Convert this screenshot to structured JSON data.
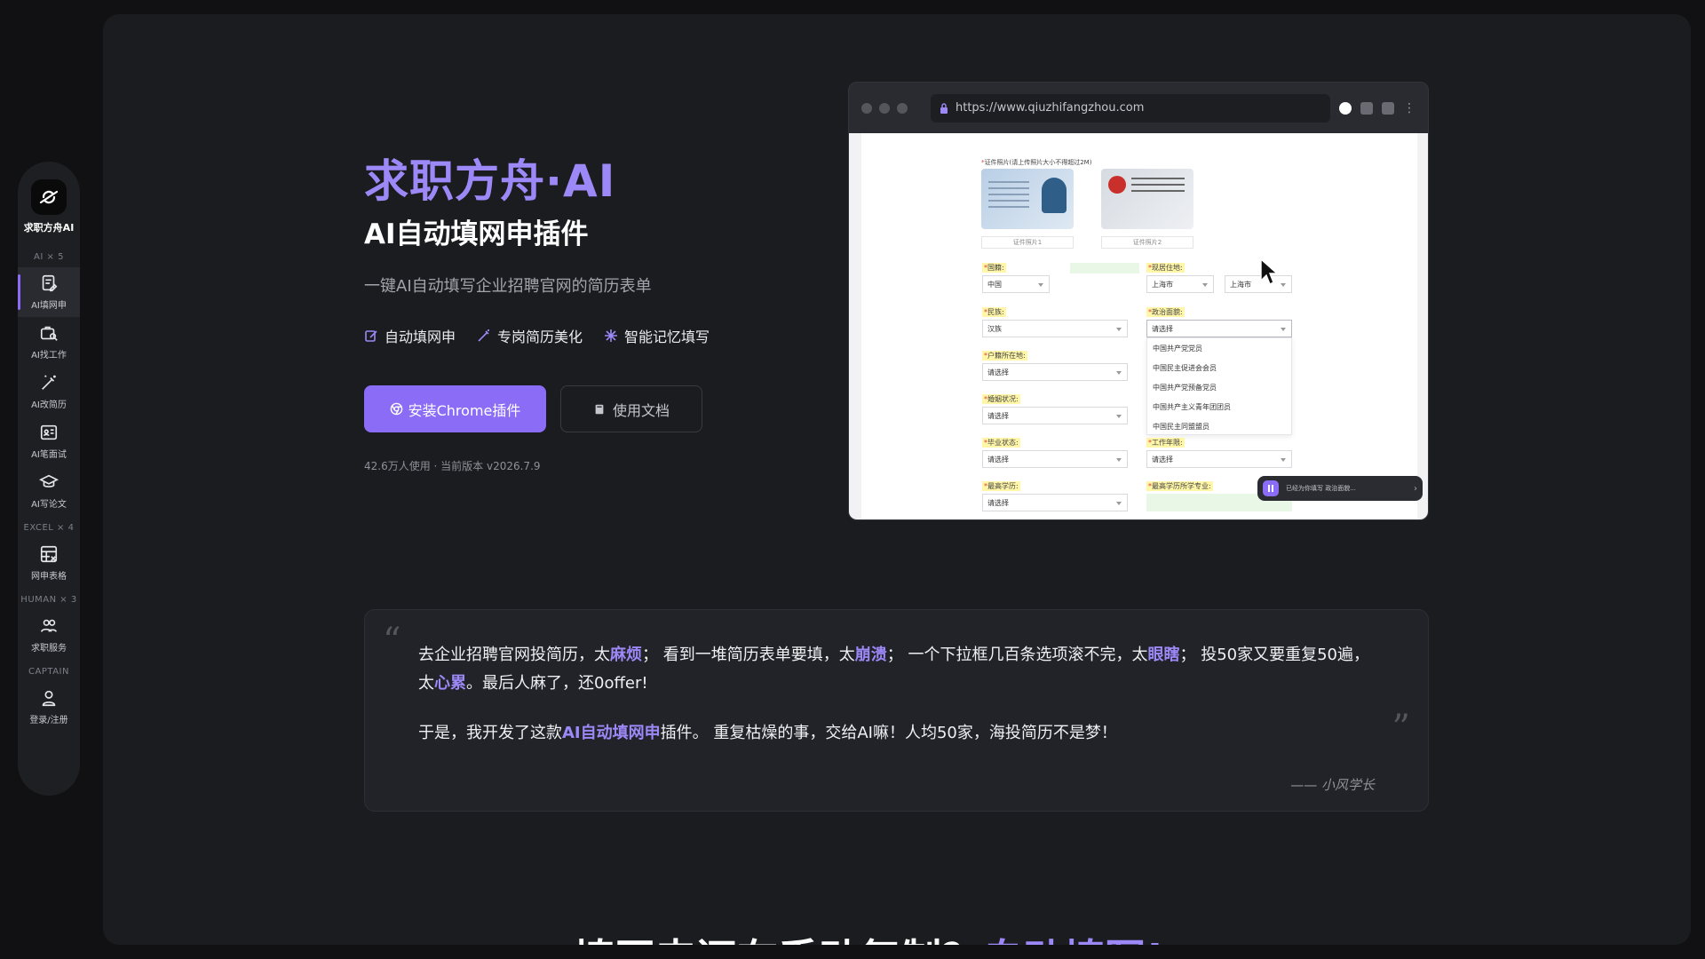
{
  "sidebar": {
    "brand": "求职方舟AI",
    "sections": {
      "ai": "AI × 5",
      "excel": "EXCEL × 4",
      "human": "HUMAN × 3",
      "captain": "CAPTAIN"
    },
    "items": [
      {
        "label": "AI填网申",
        "icon": "form-fill-icon",
        "active": true
      },
      {
        "label": "AI找工作",
        "icon": "job-search-icon"
      },
      {
        "label": "AI改简历",
        "icon": "magic-wand-icon"
      },
      {
        "label": "AI笔面试",
        "icon": "id-card-icon"
      },
      {
        "label": "AI写论文",
        "icon": "graduation-cap-icon"
      },
      {
        "label": "网申表格",
        "icon": "spreadsheet-icon"
      },
      {
        "label": "求职服务",
        "icon": "people-icon"
      },
      {
        "label": "登录/注册",
        "icon": "user-icon"
      }
    ]
  },
  "hero": {
    "title": "求职方舟·AI",
    "subtitle": "AI自动填网申插件",
    "description": "一键AI自动填写企业招聘官网的简历表单",
    "features": [
      "自动填网申",
      "专岗简历美化",
      "智能记忆填写"
    ],
    "primary_button": "安装Chrome插件",
    "secondary_button": "使用文档",
    "meta": "42.6万人使用 · 当前版本 v2026.7.9"
  },
  "browser": {
    "url": "https://www.qiuzhifangzhou.com",
    "form": {
      "upload_label": "证件照片(请上传照片大小不得超过2M)",
      "card1_caption": "证件照片1",
      "card2_caption": "证件照片2",
      "fields": [
        {
          "label": "国籍:",
          "value": "中国"
        },
        {
          "label": "现居住地:",
          "value": "上海市",
          "value2": "上海市"
        },
        {
          "label": "民族:",
          "value": "汉族"
        },
        {
          "label": "政治面貌:",
          "value": "请选择"
        },
        {
          "label": "户籍所在地:",
          "value": "请选择"
        },
        {
          "label": "婚姻状况:",
          "value": "请选择"
        },
        {
          "label": "毕业状态:",
          "value": "请选择"
        },
        {
          "label": "工作年限:",
          "value": "请选择"
        },
        {
          "label": "最高学历:",
          "value": "请选择"
        },
        {
          "label": "最高学历所学专业:",
          "value": ""
        }
      ],
      "dropdown_options": [
        "中国共产党党员",
        "中国民主促进会会员",
        "中国共产党预备党员",
        "中国共产主义青年团团员",
        "中国民主同盟盟员"
      ],
      "toast": "已经为你填写 政治面貌..."
    }
  },
  "quote": {
    "line1": [
      {
        "t": "去企业招聘官网投简历，太"
      },
      {
        "t": "麻烦",
        "hl": true
      },
      {
        "t": "；  看到一堆简历表单要填，太"
      },
      {
        "t": "崩溃",
        "hl": true
      },
      {
        "t": "；  一个下拉框几百条选项滚不完，太"
      },
      {
        "t": "眼瞎",
        "hl": true
      },
      {
        "t": "；  投50家又要重复50遍，"
      }
    ],
    "line2": [
      {
        "t": "太"
      },
      {
        "t": "心累",
        "hl": true
      },
      {
        "t": "。最后人麻了，还0offer!"
      }
    ],
    "line3": [
      {
        "t": "于是，我开发了这款"
      },
      {
        "t": "AI自动填网申",
        "hl": true
      },
      {
        "t": "插件。 重复枯燥的事，交给AI嘛！人均50家，海投简历不是梦！"
      }
    ],
    "author": "—— 小风学长"
  },
  "bottom": {
    "part1": "填网申还在手动复制？",
    "part2": "自动填写!"
  },
  "colors": {
    "accent": "#8b6cf6",
    "title": "#9d88f7",
    "panel": "#1b1c20",
    "page_bg": "#111113"
  }
}
